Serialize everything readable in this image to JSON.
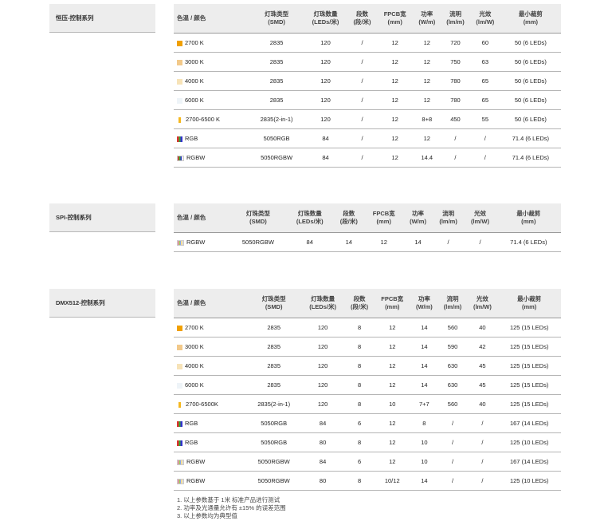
{
  "headers": [
    "色温 / 颜色",
    "灯珠类型\n(SMD)",
    "灯珠数量\n(LEDs/米)",
    "段数\n(段/米)",
    "FPCB宽\n(mm)",
    "功率\n(W/m)",
    "流明\n(lm/m)",
    "光效\n(lm/W)",
    "最小裁剪\n(mm)"
  ],
  "sections": [
    {
      "label": "恒压-控制系列",
      "rows": [
        {
          "swatch": "#f0a000",
          "type": "sq",
          "cells": [
            "2700 K",
            "2835",
            "120",
            "/",
            "12",
            "12",
            "720",
            "60",
            "50 (6 LEDs)"
          ]
        },
        {
          "swatch": "#f2c98a",
          "type": "sq",
          "cells": [
            "3000 K",
            "2835",
            "120",
            "/",
            "12",
            "12",
            "750",
            "63",
            "50 (6 LEDs)"
          ]
        },
        {
          "swatch": "#f7e3b8",
          "type": "sq",
          "cells": [
            "4000 K",
            "2835",
            "120",
            "/",
            "12",
            "12",
            "780",
            "65",
            "50 (6 LEDs)"
          ]
        },
        {
          "swatch": "#eef4f8",
          "type": "sq",
          "cells": [
            "6000 K",
            "2835",
            "120",
            "/",
            "12",
            "12",
            "780",
            "65",
            "50 (6 LEDs)"
          ]
        },
        {
          "swatch": "#f5b820",
          "type": "bar",
          "cells": [
            "2700-6500 K",
            "2835(2-in-1)",
            "120",
            "/",
            "12",
            "8+8",
            "450",
            "55",
            "50 (6 LEDs)"
          ]
        },
        {
          "swatch": "",
          "type": "rgb",
          "cells": [
            "RGB",
            "5050RGB",
            "84",
            "/",
            "12",
            "12",
            "/",
            "/",
            "71.4 (6 LEDs)"
          ]
        },
        {
          "swatch": "",
          "type": "rgbw",
          "cells": [
            "RGBW",
            "5050RGBW",
            "84",
            "/",
            "12",
            "14.4",
            "/",
            "/",
            "71.4 (6 LEDs)"
          ]
        }
      ]
    },
    {
      "label": "SPI-控制系列",
      "rows": [
        {
          "swatch": "",
          "type": "spi",
          "cells": [
            "RGBW",
            "5050RGBW",
            "84",
            "14",
            "12",
            "14",
            "/",
            "/",
            "71.4 (6 LEDs)"
          ]
        }
      ]
    },
    {
      "label": "DMX512-控制系列",
      "rows": [
        {
          "swatch": "#f0a000",
          "type": "sq",
          "cells": [
            "2700 K",
            "2835",
            "120",
            "8",
            "12",
            "14",
            "560",
            "40",
            "125 (15 LEDs)"
          ]
        },
        {
          "swatch": "#f2c98a",
          "type": "sq",
          "cells": [
            "3000 K",
            "2835",
            "120",
            "8",
            "12",
            "14",
            "590",
            "42",
            "125 (15 LEDs)"
          ]
        },
        {
          "swatch": "#f7e3b8",
          "type": "sq",
          "cells": [
            "4000 K",
            "2835",
            "120",
            "8",
            "12",
            "14",
            "630",
            "45",
            "125 (15 LEDs)"
          ]
        },
        {
          "swatch": "#eef4f8",
          "type": "sq",
          "cells": [
            "6000 K",
            "2835",
            "120",
            "8",
            "12",
            "14",
            "630",
            "45",
            "125 (15 LEDs)"
          ]
        },
        {
          "swatch": "#f5b820",
          "type": "bar",
          "cells": [
            "2700-6500K",
            "2835(2-in-1)",
            "120",
            "8",
            "10",
            "7+7",
            "560",
            "40",
            "125 (15 LEDs)"
          ]
        },
        {
          "swatch": "",
          "type": "rgb",
          "cells": [
            "RGB",
            "5050RGB",
            "84",
            "6",
            "12",
            "8",
            "/",
            "/",
            "167 (14 LEDs)"
          ]
        },
        {
          "swatch": "",
          "type": "rgb",
          "cells": [
            "RGB",
            "5050RGB",
            "80",
            "8",
            "12",
            "10",
            "/",
            "/",
            "125 (10 LEDs)"
          ]
        },
        {
          "swatch": "",
          "type": "spi",
          "cells": [
            "RGBW",
            "5050RGBW",
            "84",
            "6",
            "12",
            "10",
            "/",
            "/",
            "167 (14 LEDs)"
          ]
        },
        {
          "swatch": "",
          "type": "spi",
          "cells": [
            "RGBW",
            "5050RGBW",
            "80",
            "8",
            "10/12",
            "14",
            "/",
            "/",
            "125 (10 LEDs)"
          ]
        }
      ]
    }
  ],
  "notes": [
    "1. 以上参数基于 1米 标准产品进行测试",
    "2. 功率及光通量允许有 ±15% 的误差范围",
    "3. 以上参数均为典型值"
  ]
}
